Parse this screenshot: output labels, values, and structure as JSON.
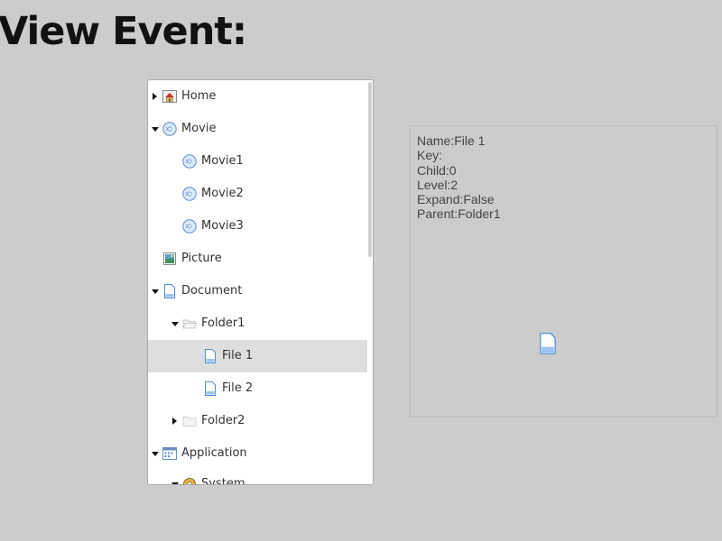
{
  "page": {
    "title": "View Event:"
  },
  "tree": {
    "nodes": [
      {
        "label": "Home",
        "icon": "home-icon",
        "expander": "collapsed"
      },
      {
        "label": "Movie",
        "icon": "movie-disc-icon",
        "expander": "expanded"
      },
      {
        "label": "Movie1",
        "icon": "movie-disc-icon",
        "expander": "none"
      },
      {
        "label": "Movie2",
        "icon": "movie-disc-icon",
        "expander": "none"
      },
      {
        "label": "Movie3",
        "icon": "movie-disc-icon",
        "expander": "none"
      },
      {
        "label": "Picture",
        "icon": "picture-icon",
        "expander": "none"
      },
      {
        "label": "Document",
        "icon": "document-icon",
        "expander": "expanded"
      },
      {
        "label": "Folder1",
        "icon": "folder-open-icon",
        "expander": "expanded"
      },
      {
        "label": "File 1",
        "icon": "file-icon",
        "expander": "none",
        "selected": true
      },
      {
        "label": "File 2",
        "icon": "file-icon",
        "expander": "none"
      },
      {
        "label": "Folder2",
        "icon": "folder-icon",
        "expander": "collapsed"
      },
      {
        "label": "Application",
        "icon": "application-icon",
        "expander": "expanded"
      },
      {
        "label": "System",
        "icon": "system-icon",
        "expander": "expanded"
      }
    ]
  },
  "info": {
    "name": "Name:File 1",
    "key": "Key:",
    "child": "Child:0",
    "level": "Level:2",
    "expand": "Expand:False",
    "parent": "Parent:Folder1",
    "icon": "file-icon"
  },
  "colors": {
    "background": "#cccccc",
    "selected_row": "#dedede",
    "icon_blue": "#4a90d9"
  }
}
